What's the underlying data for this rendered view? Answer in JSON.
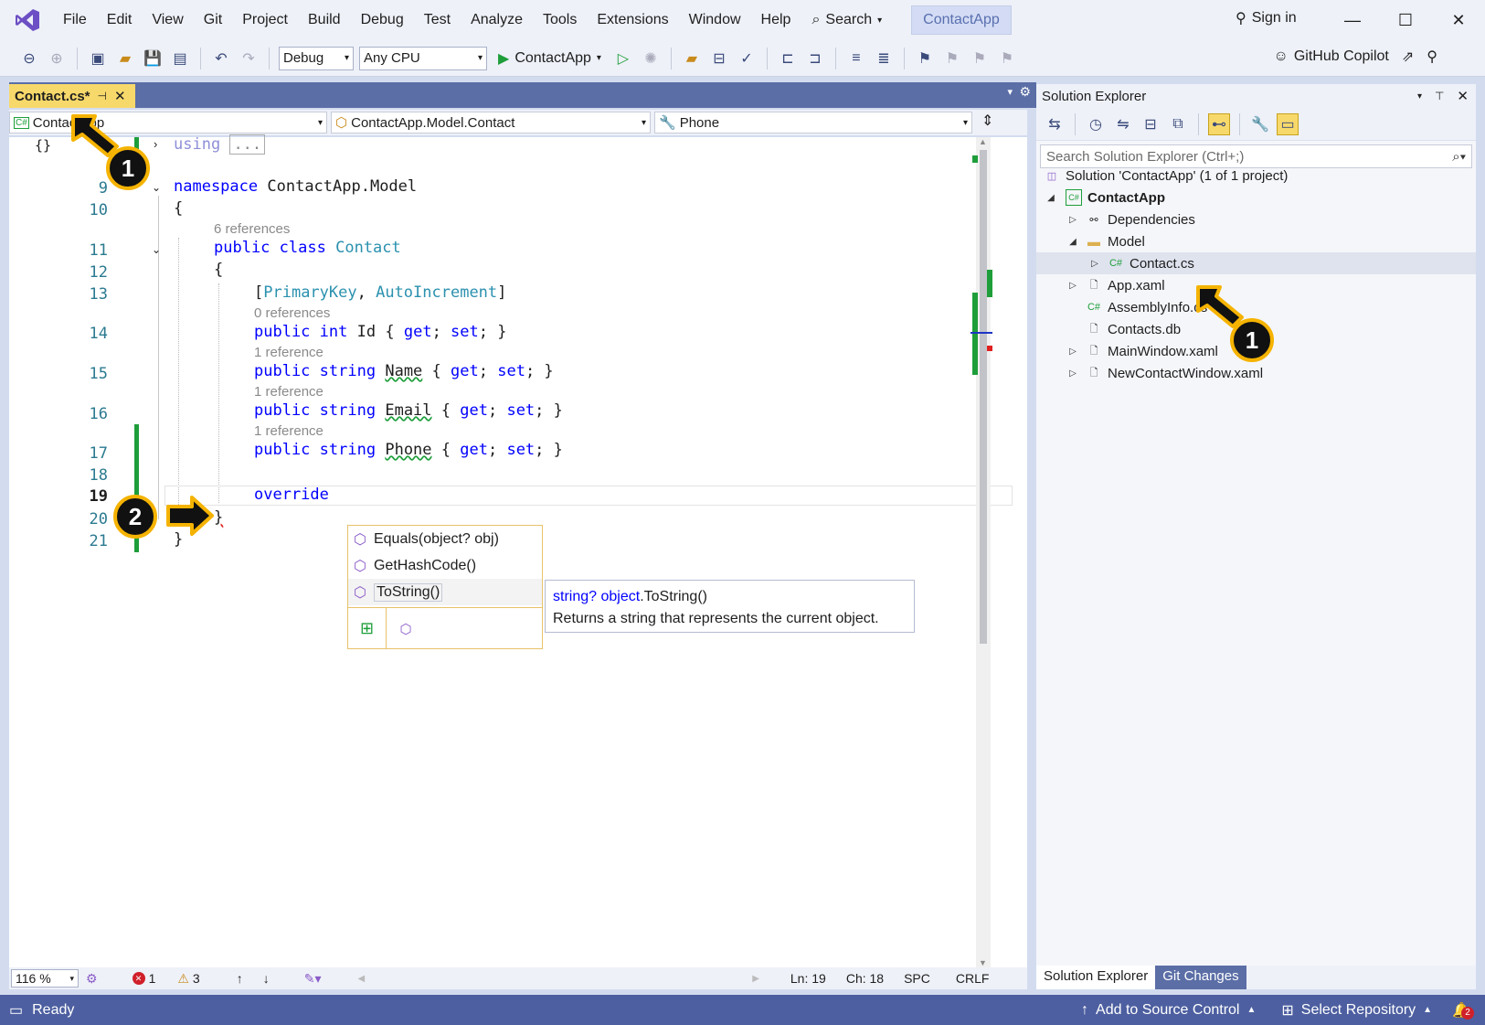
{
  "titlebar": {
    "menu": [
      "File",
      "Edit",
      "View",
      "Git",
      "Project",
      "Build",
      "Debug",
      "Test",
      "Analyze",
      "Tools",
      "Extensions",
      "Window",
      "Help"
    ],
    "search_label": "Search",
    "app_name": "ContactApp",
    "sign_in": "Sign in"
  },
  "toolbar": {
    "config": "Debug",
    "platform": "Any CPU",
    "run_target": "ContactApp",
    "copilot": "GitHub Copilot"
  },
  "doc_tab": {
    "label": "Contact.cs*"
  },
  "navbar": {
    "project": "ContactApp",
    "type": "ContactApp.Model.Contact",
    "member": "Phone"
  },
  "code": {
    "using_kw": "using",
    "collapsed": "...",
    "namespace_kw": "namespace",
    "namespace_name": "ContactApp.Model",
    "refs_class": "6 references",
    "public": "public",
    "class_kw": "class",
    "class_name": "Contact",
    "attr_open": "[",
    "attr1": "PrimaryKey",
    "attr_sep": ", ",
    "attr2": "AutoIncrement",
    "attr_close": "]",
    "refs_id": "0 references",
    "refs_name": "1 reference",
    "refs_email": "1 reference",
    "refs_phone": "1 reference",
    "int_kw": "int",
    "string_kw": "string",
    "prop_id": "Id",
    "prop_name": "Name",
    "prop_email": "Email",
    "prop_phone": "Phone",
    "get_kw": "get",
    "set_kw": "set",
    "override_kw": "override",
    "brace_open": "{",
    "brace_close": "}",
    "line_numbers": [
      "9",
      "10",
      "11",
      "12",
      "13",
      "14",
      "15",
      "16",
      "17",
      "18",
      "19",
      "20",
      "21"
    ]
  },
  "completion": {
    "items": [
      "Equals(object? obj)",
      "GetHashCode()",
      "ToString()"
    ],
    "tooltip_sig_type": "string?",
    "tooltip_sig_obj": "object",
    "tooltip_sig_method": ".ToString()",
    "tooltip_desc": "Returns a string that represents the current object."
  },
  "editor_status": {
    "zoom": "116 %",
    "errors": "1",
    "warnings": "3",
    "ln": "Ln: 19",
    "ch": "Ch: 18",
    "spc": "SPC",
    "crlf": "CRLF"
  },
  "solution_explorer": {
    "title": "Solution Explorer",
    "search_placeholder": "Search Solution Explorer (Ctrl+;)",
    "solution": "Solution 'ContactApp' (1 of 1 project)",
    "project": "ContactApp",
    "dependencies": "Dependencies",
    "model": "Model",
    "contact_cs": "Contact.cs",
    "app_xaml": "App.xaml",
    "assemblyinfo": "AssemblyInfo.cs",
    "contacts_db": "Contacts.db",
    "mainwindow": "MainWindow.xaml",
    "newcontact": "NewContactWindow.xaml",
    "tab_se": "Solution Explorer",
    "tab_git": "Git Changes"
  },
  "statusbar": {
    "ready": "Ready",
    "add_source": "Add to Source Control",
    "select_repo": "Select Repository",
    "notif_count": "2"
  },
  "annotations": {
    "step1": "1",
    "step2": "2"
  },
  "colors": {
    "accent": "#5b6ea6",
    "tab_active": "#f7d96b",
    "annotation": "#f5b301",
    "keyword": "#0000ff",
    "type": "#2b91af"
  }
}
